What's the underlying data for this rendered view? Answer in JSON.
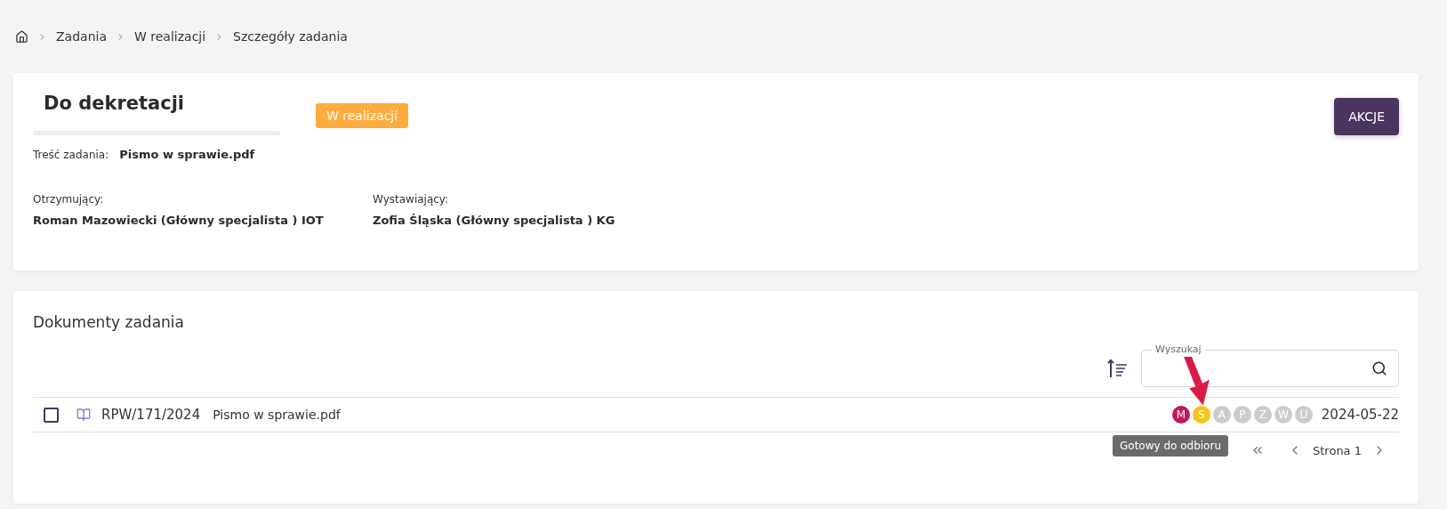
{
  "breadcrumb": [
    {
      "label": "Zadania"
    },
    {
      "label": "W realizacji"
    },
    {
      "label": "Szczegóły zadania"
    }
  ],
  "task": {
    "title": "Do dekretacji",
    "status": "W realizacji",
    "action": "AKCJE",
    "content_label": "Treść zadania:",
    "content_value": "Pismo w sprawie.pdf",
    "people": [
      {
        "label": "Otrzymujący:",
        "value": "Roman Mazowiecki (Główny specjalista ) IOT"
      },
      {
        "label": "Wystawiający:",
        "value": "Zofia Śląska (Główny specjalista ) KG"
      }
    ]
  },
  "documents": {
    "title": "Dokumenty zadania",
    "search": {
      "label": "Wyszukaj"
    },
    "rows": [
      {
        "checked": false,
        "number": "RPW/171/2024",
        "name": "Pismo w sprawie.pdf",
        "date": "2024-05-22",
        "statuses": [
          {
            "letter": "M",
            "color": "#c2185b"
          },
          {
            "letter": "S",
            "color": "#f5c518"
          },
          {
            "letter": "A",
            "color": "#cccccc"
          },
          {
            "letter": "P",
            "color": "#cccccc"
          },
          {
            "letter": "Z",
            "color": "#cccccc"
          },
          {
            "letter": "W",
            "color": "#cccccc"
          },
          {
            "letter": "U",
            "color": "#cccccc"
          }
        ]
      }
    ],
    "tooltip": "Gotowy do odbioru",
    "page": "Strona 1"
  }
}
